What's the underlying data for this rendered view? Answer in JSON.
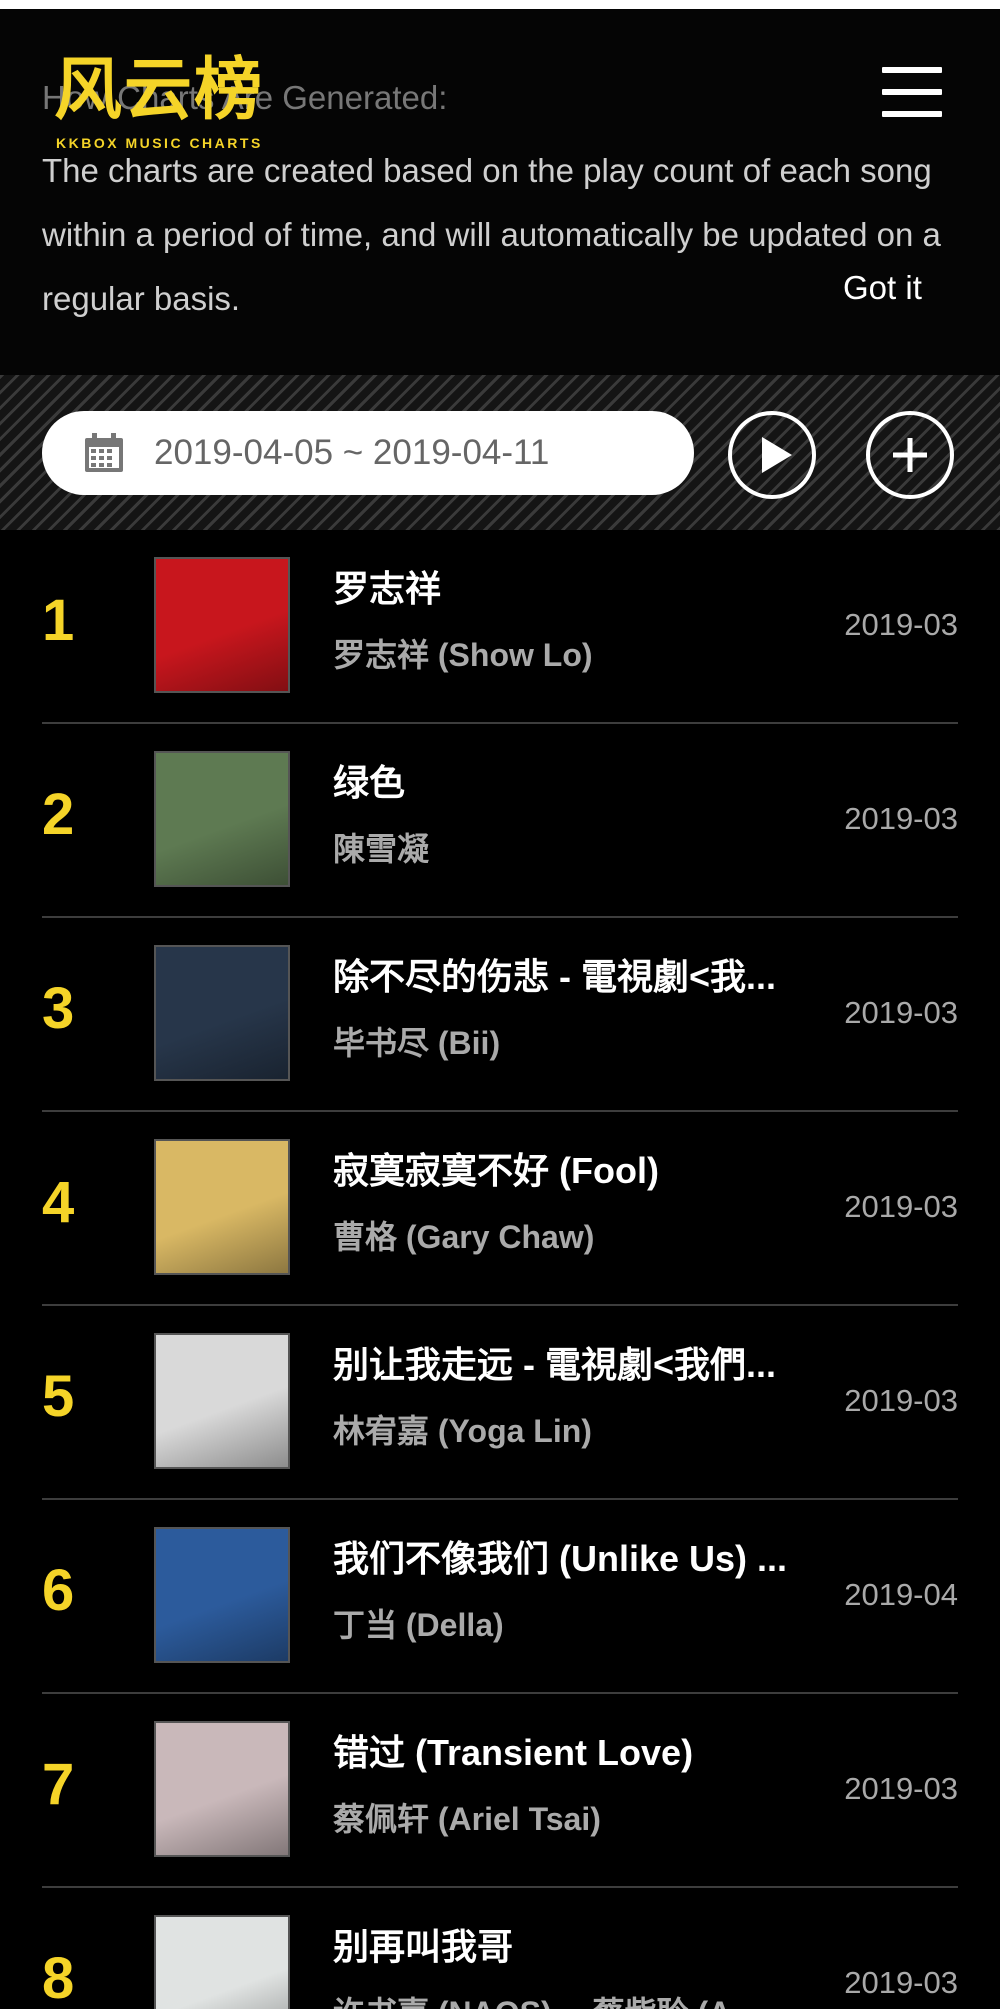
{
  "notice": {
    "title": "How Charts Are Generated:",
    "text": "The charts are created based on the play count of each song within a period of time, and will automatically be updated on a regular basis.",
    "dismiss_label": "Got it"
  },
  "logo": {
    "main": "风云榜",
    "sub": "KKBOX MUSIC CHARTS"
  },
  "controls": {
    "date_range": "2019-04-05 ~ 2019-04-11",
    "icons": [
      "calendar-icon",
      "play-icon",
      "plus-icon",
      "menu-icon"
    ]
  },
  "colors": {
    "accent": "#f5d428",
    "background": "#000000"
  },
  "chart": [
    {
      "rank": "1",
      "title": "罗志祥",
      "artist": "罗志祥 (Show Lo)",
      "date": "2019-03",
      "cover_color": "#c8161d"
    },
    {
      "rank": "2",
      "title": "绿色",
      "artist": "陳雪凝",
      "date": "2019-03",
      "cover_color": "#5e7a52"
    },
    {
      "rank": "3",
      "title": "除不尽的伤悲 - 電視劇<我...",
      "artist": "毕书尽 (Bii)",
      "date": "2019-03",
      "cover_color": "#27364a"
    },
    {
      "rank": "4",
      "title": "寂寞寂寞不好 (Fool)",
      "artist": "曹格 (Gary Chaw)",
      "date": "2019-03",
      "cover_color": "#d9b864"
    },
    {
      "rank": "5",
      "title": "别让我走远 - 電視劇<我們...",
      "artist": "林宥嘉 (Yoga Lin)",
      "date": "2019-03",
      "cover_color": "#d9d9d9"
    },
    {
      "rank": "6",
      "title": "我们不像我们 (Unlike Us) ...",
      "artist": "丁当 (Della)",
      "date": "2019-04",
      "cover_color": "#2c5b9c"
    },
    {
      "rank": "7",
      "title": "错过 (Transient Love)",
      "artist": "蔡佩轩 (Ariel Tsai)",
      "date": "2019-03",
      "cover_color": "#c9b8ba"
    },
    {
      "rank": "8",
      "title": "别再叫我哥",
      "artist": "许书嘉 (NAOS)、 蔡紫聆 (A...",
      "date": "2019-03",
      "cover_color": "#e0e3e2"
    }
  ]
}
